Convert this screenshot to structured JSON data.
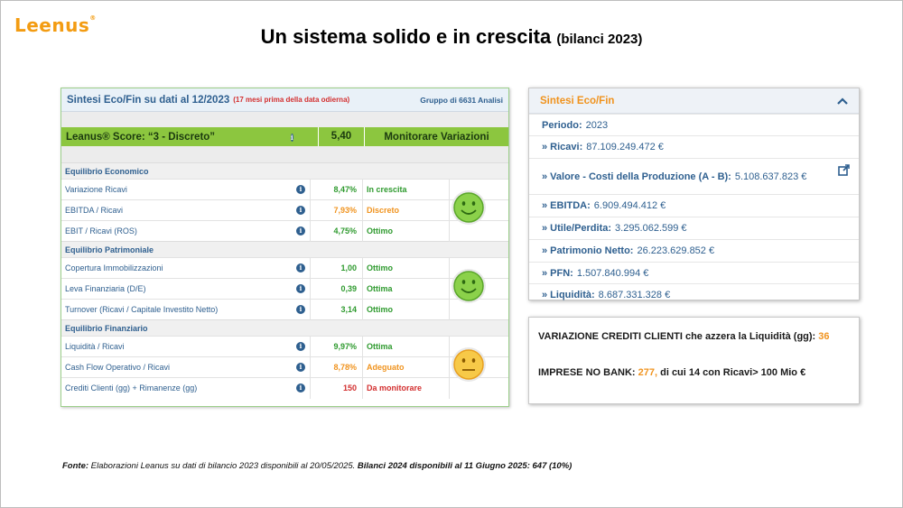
{
  "logo": "Leenus",
  "title": {
    "main": "Un sistema solido e in crescita",
    "sub": "(bilanci 2023)"
  },
  "table": {
    "header": "Sintesi Eco/Fin su dati al 12/2023",
    "header_note": "(17 mesi prima della data odierna)",
    "group": "Gruppo di 6631 Analisi",
    "score_label": "Leanus® Score: “3 - Discreto”",
    "score_value": "5,40",
    "score_msg": "Monitorare Variazioni",
    "sections": [
      {
        "title": "Equilibrio Economico",
        "face": "happy",
        "rows": [
          {
            "label": "Variazione Ricavi",
            "value": "8,47%",
            "status": "In crescita",
            "color": "green"
          },
          {
            "label": "EBITDA / Ricavi",
            "value": "7,93%",
            "status": "Discreto",
            "color": "orange"
          },
          {
            "label": "EBIT / Ricavi (ROS)",
            "value": "4,75%",
            "status": "Ottimo",
            "color": "green"
          }
        ]
      },
      {
        "title": "Equilibrio Patrimoniale",
        "face": "happy",
        "rows": [
          {
            "label": "Copertura Immobilizzazioni",
            "value": "1,00",
            "status": "Ottimo",
            "color": "green"
          },
          {
            "label": "Leva Finanziaria (D/E)",
            "value": "0,39",
            "status": "Ottima",
            "color": "green"
          },
          {
            "label": "Turnover (Ricavi / Capitale Investito Netto)",
            "value": "3,14",
            "status": "Ottimo",
            "color": "green"
          }
        ]
      },
      {
        "title": "Equilibrio Finanziario",
        "face": "neutral",
        "rows": [
          {
            "label": "Liquidità / Ricavi",
            "value": "9,97%",
            "status": "Ottima",
            "color": "green"
          },
          {
            "label": "Cash Flow Operativo / Ricavi",
            "value": "8,78%",
            "status": "Adeguato",
            "color": "orange"
          },
          {
            "label": "Crediti Clienti (gg) + Rimanenze (gg)",
            "value": "150",
            "status": "Da monitorare",
            "color": "red"
          }
        ]
      }
    ]
  },
  "panel": {
    "title": "Sintesi Eco/Fin",
    "rows": [
      {
        "label": "Periodo:",
        "value": "2023"
      },
      {
        "label": "» Ricavi:",
        "value": "87.109.249.472 €"
      },
      {
        "label": "» Valore - Costi della Produzione (A - B):",
        "value": "5.108.637.823 €"
      },
      {
        "label": "» EBITDA:",
        "value": "6.909.494.412 €"
      },
      {
        "label": "» Utile/Perdita:",
        "value": "3.295.062.599 €"
      },
      {
        "label": "» Patrimonio Netto:",
        "value": "26.223.629.852 €"
      },
      {
        "label": "» PFN:",
        "value": "1.507.840.994 €"
      },
      {
        "label": "» Liquidità:",
        "value": "8.687.331.328 €"
      }
    ]
  },
  "box": {
    "line1_text": "VARIAZIONE CREDITI CLIENTI che azzera la Liquidità (gg):",
    "line1_value": "36",
    "line2_text": "IMPRESE NO BANK:",
    "line2_value": "277,",
    "line2_rest": "di cui 14 con Ricavi> 100 Mio €"
  },
  "footer": {
    "label": "Fonte:",
    "text": "Elaborazioni Leanus su dati di bilancio 2023 disponibili al 20/05/2025.",
    "bold": "Bilanci 2024 disponibili al 11 Giugno 2025: 647 (10%)"
  },
  "colors": {
    "green": "#2e9a2e",
    "orange": "#f0931e",
    "red": "#d32f2f",
    "score_bg": "#8cc63f",
    "accent": "#2e5f8f"
  }
}
